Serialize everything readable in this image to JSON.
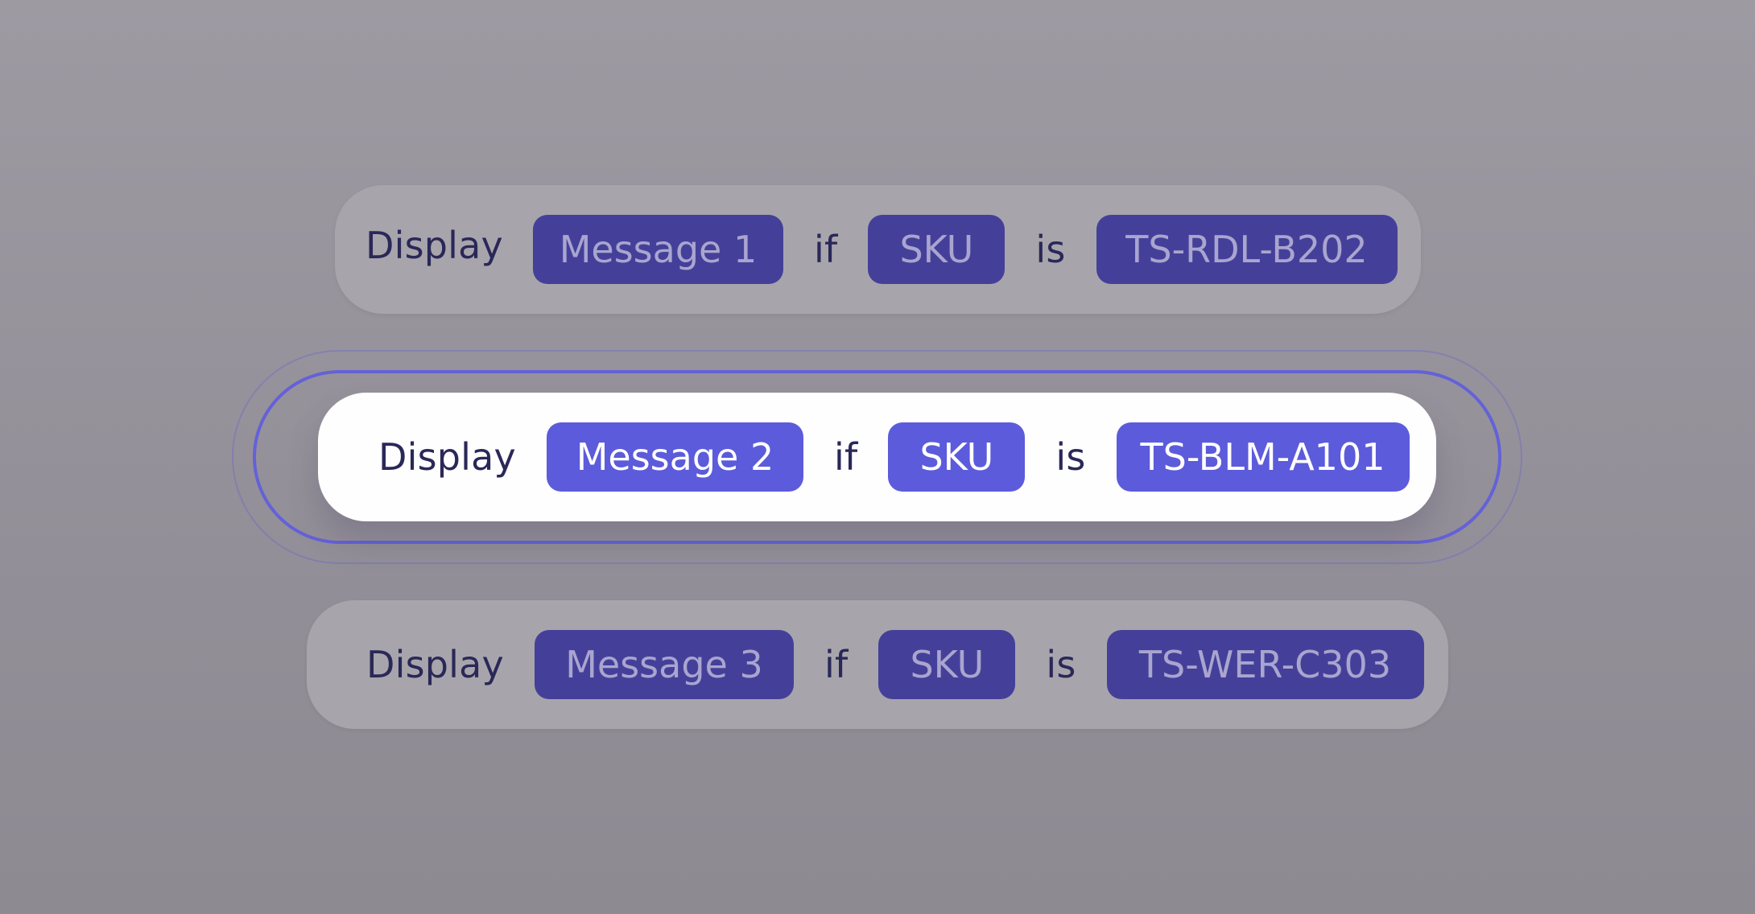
{
  "rules": [
    {
      "state": "inactive",
      "prefix": "Display",
      "message": "Message 1",
      "conjunction": "if",
      "field": "SKU",
      "operator": "is",
      "value": "TS-RDL-B202"
    },
    {
      "state": "active",
      "prefix": "Display",
      "message": "Message 2",
      "conjunction": "if",
      "field": "SKU",
      "operator": "is",
      "value": "TS-BLM-A101"
    },
    {
      "state": "inactive",
      "prefix": "Display",
      "message": "Message 3",
      "conjunction": "if",
      "field": "SKU",
      "operator": "is",
      "value": "TS-WER-C303"
    }
  ],
  "colors": {
    "accent": "#5c5bdb",
    "accent_dim": "#44409a",
    "text_dark": "#2a2858",
    "background": "#969399"
  }
}
